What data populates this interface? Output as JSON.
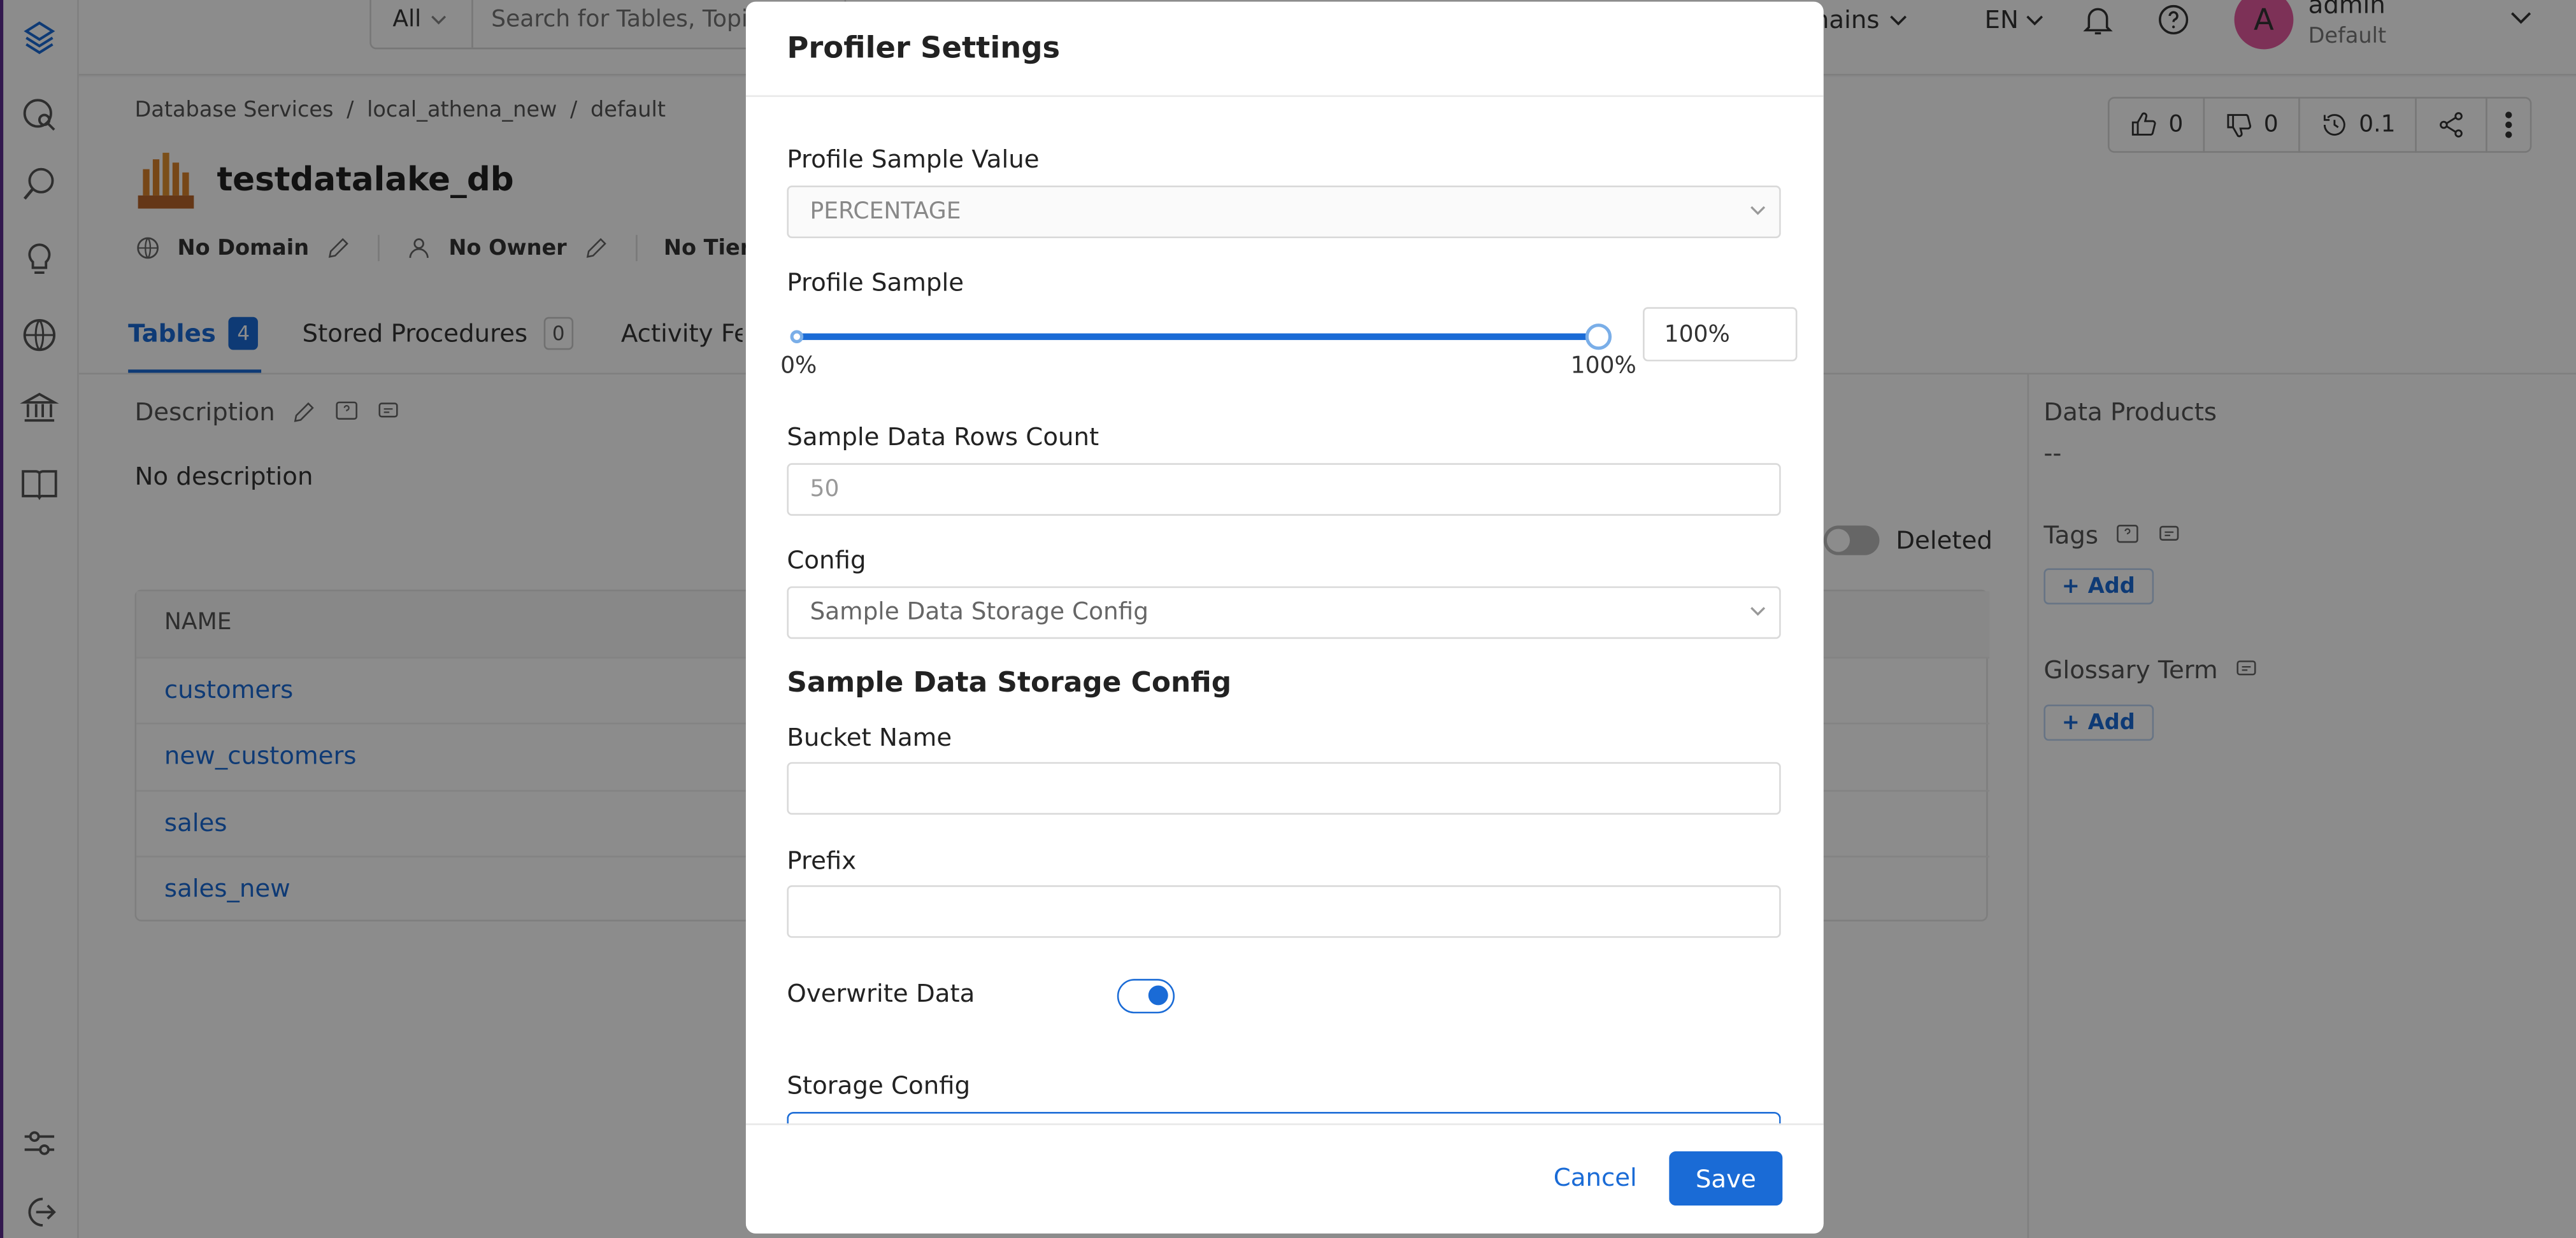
{
  "topbar": {
    "search_type": "All",
    "search_placeholder": "Search for Tables, Topics, Dashboards",
    "domains_label": "Domains",
    "language": "EN",
    "user_initial": "A",
    "user_name": "admin",
    "user_role": "Default"
  },
  "breadcrumb": [
    "Database Services",
    "local_athena_new",
    "default"
  ],
  "breadcrumb_sep": "/",
  "entity": {
    "title": "testdatalake_db",
    "domain": "No Domain",
    "owner": "No Owner",
    "tier": "No Tier"
  },
  "actions": {
    "upvotes": "0",
    "downvotes": "0",
    "version": "0.1"
  },
  "tabs": [
    {
      "label": "Tables",
      "count": "4"
    },
    {
      "label": "Stored Procedures",
      "count": "0"
    },
    {
      "label": "Activity Feeds & Tasks",
      "count": ""
    }
  ],
  "description": {
    "label": "Description",
    "value": "No description"
  },
  "deleted_toggle_label": "Deleted",
  "table": {
    "header_name": "NAME",
    "rows": [
      "customers",
      "new_customers",
      "sales",
      "sales_new"
    ]
  },
  "right_panel": {
    "data_products_label": "Data Products",
    "data_products_value": "--",
    "tags_label": "Tags",
    "glossary_label": "Glossary Term",
    "add_label": "Add"
  },
  "modal": {
    "title": "Profiler Settings",
    "profile_sample_value_label": "Profile Sample Value",
    "profile_sample_value": "PERCENTAGE",
    "profile_sample_label": "Profile Sample",
    "slider_min_label": "0%",
    "slider_max_label": "100%",
    "slider_value_percent": 100,
    "profile_sample_input": "100%",
    "sample_rows_label": "Sample Data Rows Count",
    "sample_rows_value": "50",
    "config_label": "Config",
    "config_value": "Sample Data Storage Config",
    "storage_section_title": "Sample Data Storage Config",
    "bucket_name_label": "Bucket Name",
    "bucket_name_value": "",
    "prefix_label": "Prefix",
    "prefix_value": "",
    "overwrite_label": "Overwrite Data",
    "overwrite_on": true,
    "storage_config_label": "Storage Config",
    "cancel_label": "Cancel",
    "save_label": "Save"
  },
  "colors": {
    "primary": "#1a6bd6",
    "avatar": "#e35a9f",
    "rail_accent": "#5b2d8e"
  }
}
